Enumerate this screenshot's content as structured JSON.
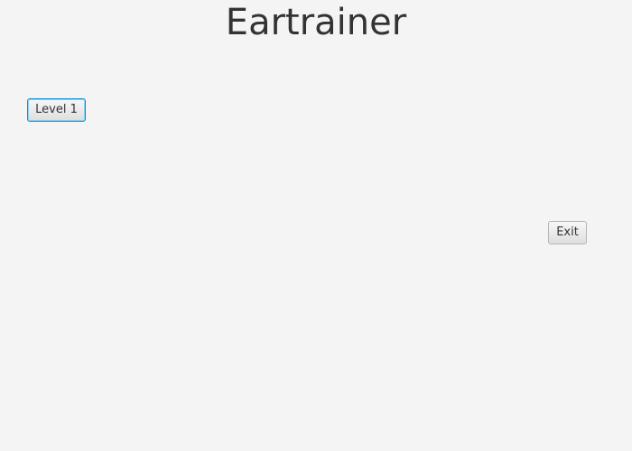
{
  "window": {
    "title": "Eartrainer"
  },
  "buttons": {
    "level_label": "Level 1",
    "exit_label": "Exit"
  },
  "colors": {
    "background": "#f4f4f4",
    "text": "#333333",
    "focus_border": "#0396d6"
  }
}
